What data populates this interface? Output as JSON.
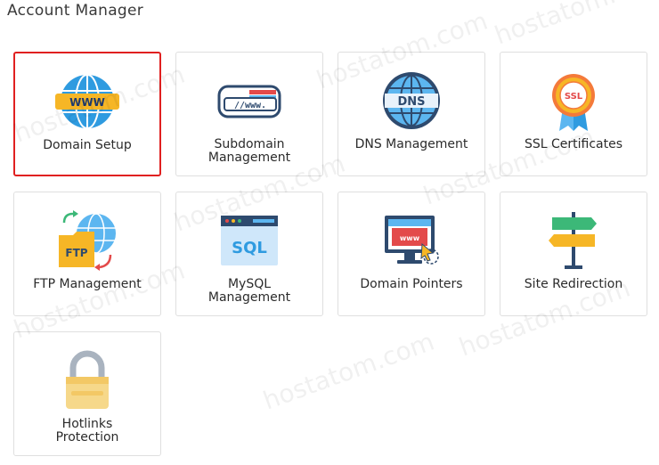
{
  "page": {
    "title": "Account Manager",
    "watermark_text": "hostatom.com"
  },
  "tiles": [
    {
      "label_lines": [
        "Domain Setup"
      ],
      "icon": "globe-www-icon",
      "selected": true
    },
    {
      "label_lines": [
        "Subdomain",
        "Management"
      ],
      "icon": "browser-www-icon",
      "selected": false
    },
    {
      "label_lines": [
        "DNS Management"
      ],
      "icon": "dns-globe-icon",
      "selected": false
    },
    {
      "label_lines": [
        "SSL Certificates"
      ],
      "icon": "ssl-badge-icon",
      "selected": false
    },
    {
      "label_lines": [
        "FTP Management"
      ],
      "icon": "ftp-folder-globe-icon",
      "selected": false
    },
    {
      "label_lines": [
        "MySQL",
        "Management"
      ],
      "icon": "sql-database-icon",
      "selected": false
    },
    {
      "label_lines": [
        "Domain Pointers"
      ],
      "icon": "monitor-pointer-icon",
      "selected": false
    },
    {
      "label_lines": [
        "Site Redirection"
      ],
      "icon": "signpost-icon",
      "selected": false
    },
    {
      "label_lines": [
        "Hotlinks",
        "Protection"
      ],
      "icon": "padlock-icon",
      "selected": false
    }
  ],
  "colors": {
    "selected_border": "#e02020",
    "tile_border": "#dfdfdf",
    "text": "#2b2b2b"
  }
}
